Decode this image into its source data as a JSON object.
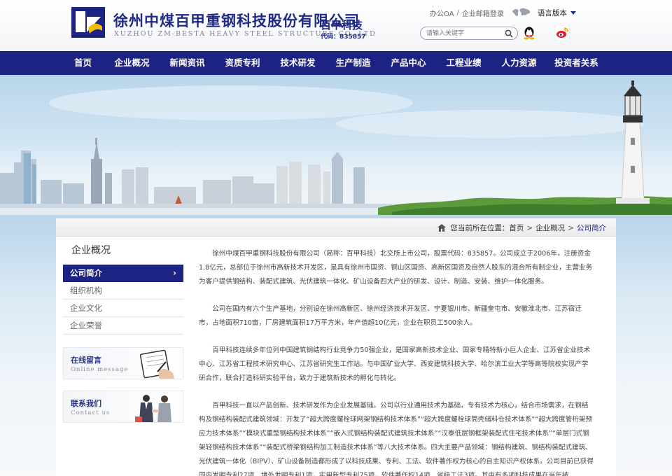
{
  "header": {
    "company_cn": "徐州中煤百甲重钢科技股份有限公司",
    "company_en": "XUZHOU ZM-BESTA HEAVY STEEL STRUCTURE CO.,LTD",
    "brand_name": "百甲科技",
    "brand_code": "代码：835857",
    "links": {
      "oa": "办公OA",
      "sep": "/",
      "mail": "企业邮箱登录",
      "language": "语言版本"
    },
    "search_placeholder": "请输入关键字"
  },
  "nav": {
    "items": [
      "首页",
      "企业概况",
      "新闻资讯",
      "资质专利",
      "技术研发",
      "生产制造",
      "产品中心",
      "工程业绩",
      "人力资源",
      "投资者关系"
    ]
  },
  "breadcrumb": {
    "prefix": "您当前所在位置：",
    "home": "首页",
    "section": "企业概况",
    "current": "公司简介",
    "gt": ">"
  },
  "sidebar": {
    "title": "企业概况",
    "items": [
      "公司简介",
      "组织机构",
      "企业文化",
      "企业荣誉"
    ],
    "active_arrow": "›",
    "promo_message": {
      "title": "在线留言",
      "subtitle": "Online message"
    },
    "promo_contact": {
      "title": "联系我们",
      "subtitle": "Contact us"
    }
  },
  "article": {
    "paragraphs": [
      "徐州中煤百甲重钢科技股份有限公司（简称：百甲科技）北交所上市公司，股票代码：835857。公司成立于2006年，注册资金1.8亿元，总部位于徐州市高新技术开发区，是具有徐州市国资、铜山区国资、高新区国资及自然人股东的混合所有制企业，主营业务为客户提供钢结构、装配式建筑、光伏建筑一体化、矿山设备四大产业的研发、设计、制造、安装、维护一体化服务。",
      "公司在国内有六个生产基地，分别设在徐州高新区、徐州经济技术开发区、宁夏银川市、新疆奎屯市、安徽淮北市、江苏宿迁市，占地面积710亩，厂房建筑面积17万平方米，年产值超10亿元，企业在职员工500余人。",
      "百甲科技连续多年位列中国建筑钢结构行业竞争力50强企业，是国家高新技术企业、国家专精特新小巨人企业、江苏省企业技术中心、江苏省工程技术研究中心、江苏省研究生工作站。与中国矿业大学、西安建筑科技大学、哈尔滨工业大学等高等院校实现产学研合作，联合打造科研实验平台，致力于建筑新技术的孵化与转化。",
      "百甲科技一直以产品创新、技术研发作为企业发展基础。公司以行业通用技术为基础，专有技术为核心，结合市场需求，在钢结构及钢结构装配式建筑领域：开发了“超大跨度螺栓球网架钢结构技术体系”“超大跨度螺栓球筒壳储料仓技术体系”“超大跨度管桁架预应力技术体系”“模块式重型钢结构技术体系”“嵌入式钢结构装配式建筑技术体系”“汉泰低层钢框架装配式住宅技术体系”“单层门式钢架轻钢结构技术体系”“装配式桥梁钢结构加工制造技术体系”等八大技术体系。四大主要产品领域：钢结构建筑、钢结构装配式建筑、光伏建筑一体化（BIPV）、矿山设备制造都形成了以科技成果、专利、工法、软件著作权为核心的自主知识产权体系。公司目前已获得国内发明专利27项、境外发明专利1项，实用新型专利75项，软件著作权14项、省级工法3项。其中有多项科技成果在当年被"
    ]
  },
  "colors": {
    "brand_blue": "#1c2382",
    "title_blue": "#1f2a86",
    "text": "#444444"
  }
}
